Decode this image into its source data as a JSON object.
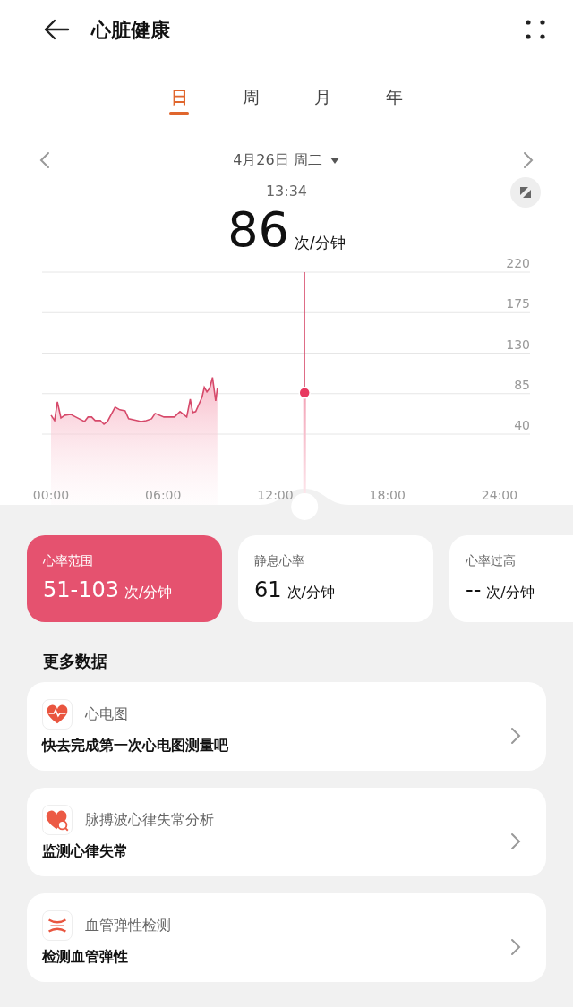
{
  "header": {
    "title": "心脏健康"
  },
  "tabs": [
    {
      "label": "日",
      "selected": true
    },
    {
      "label": "周",
      "selected": false
    },
    {
      "label": "月",
      "selected": false
    },
    {
      "label": "年",
      "selected": false
    }
  ],
  "date": {
    "label": "4月26日 周二"
  },
  "reading": {
    "time": "13:34",
    "value": "86",
    "unit": "次/分钟"
  },
  "chart_data": {
    "type": "area",
    "x": [
      0,
      0.19,
      0.34,
      0.53,
      0.75,
      1.04,
      1.32,
      1.79,
      1.98,
      2.17,
      2.36,
      2.64,
      2.83,
      3.02,
      3.43,
      3.68,
      3.96,
      4.15,
      4.62,
      4.81,
      5.09,
      5.38,
      5.57,
      6.04,
      6.6,
      6.9,
      7.26,
      7.45,
      7.58,
      7.74,
      8.08,
      8.2,
      8.34,
      8.49,
      8.64,
      8.81,
      8.9
    ],
    "series": [
      {
        "color": "#d6496a",
        "values": [
          61,
          55,
          76,
          58,
          61,
          62,
          59,
          54,
          59,
          59,
          55,
          55,
          51,
          54,
          70,
          67,
          66,
          57,
          55,
          54,
          55,
          57,
          63,
          59,
          59,
          65,
          59,
          79,
          64,
          65,
          81,
          92,
          87,
          91,
          103,
          77,
          91
        ]
      }
    ],
    "xlim": [
      0,
      24
    ],
    "ylim": [
      40,
      220
    ],
    "xticks": [
      {
        "value": 0,
        "label": "00:00"
      },
      {
        "value": 6,
        "label": "06:00"
      },
      {
        "value": 12,
        "label": "12:00"
      },
      {
        "value": 18,
        "label": "18:00"
      },
      {
        "value": 24,
        "label": "24:00"
      }
    ],
    "yticks": [
      40,
      85,
      130,
      175,
      220
    ],
    "grid": true
  },
  "stats": [
    {
      "label": "心率范围",
      "value": "51-103",
      "unit": "次/分钟",
      "selected": true
    },
    {
      "label": "静息心率",
      "value": "61",
      "unit": "次/分钟",
      "selected": false
    },
    {
      "label": "心率过高",
      "value": "--",
      "unit": "次/分钟",
      "selected": false
    }
  ],
  "more": {
    "title": "更多数据",
    "items": [
      {
        "kind": "ecg",
        "title": "心电图",
        "subtitle": "快去完成第一次心电图测量吧"
      },
      {
        "kind": "pulse",
        "title": "脉搏波心律失常分析",
        "subtitle": "监测心律失常"
      },
      {
        "kind": "vessel",
        "title": "血管弹性检测",
        "subtitle": "检测血管弹性"
      }
    ]
  }
}
